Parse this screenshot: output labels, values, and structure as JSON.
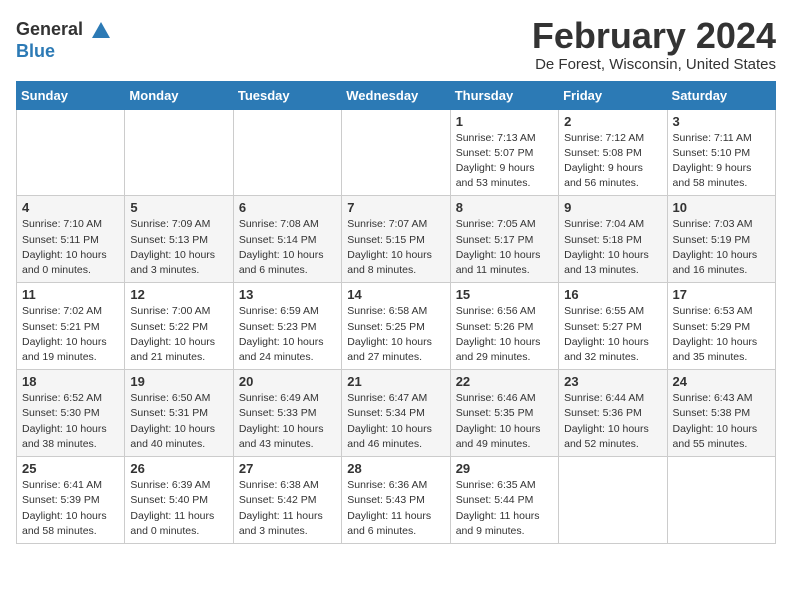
{
  "header": {
    "logo_general": "General",
    "logo_blue": "Blue",
    "month_title": "February 2024",
    "location": "De Forest, Wisconsin, United States"
  },
  "weekdays": [
    "Sunday",
    "Monday",
    "Tuesday",
    "Wednesday",
    "Thursday",
    "Friday",
    "Saturday"
  ],
  "weeks": [
    [
      {
        "day": "",
        "info": ""
      },
      {
        "day": "",
        "info": ""
      },
      {
        "day": "",
        "info": ""
      },
      {
        "day": "",
        "info": ""
      },
      {
        "day": "1",
        "sunrise": "Sunrise: 7:13 AM",
        "sunset": "Sunset: 5:07 PM",
        "daylight": "Daylight: 9 hours and 53 minutes."
      },
      {
        "day": "2",
        "sunrise": "Sunrise: 7:12 AM",
        "sunset": "Sunset: 5:08 PM",
        "daylight": "Daylight: 9 hours and 56 minutes."
      },
      {
        "day": "3",
        "sunrise": "Sunrise: 7:11 AM",
        "sunset": "Sunset: 5:10 PM",
        "daylight": "Daylight: 9 hours and 58 minutes."
      }
    ],
    [
      {
        "day": "4",
        "sunrise": "Sunrise: 7:10 AM",
        "sunset": "Sunset: 5:11 PM",
        "daylight": "Daylight: 10 hours and 0 minutes."
      },
      {
        "day": "5",
        "sunrise": "Sunrise: 7:09 AM",
        "sunset": "Sunset: 5:13 PM",
        "daylight": "Daylight: 10 hours and 3 minutes."
      },
      {
        "day": "6",
        "sunrise": "Sunrise: 7:08 AM",
        "sunset": "Sunset: 5:14 PM",
        "daylight": "Daylight: 10 hours and 6 minutes."
      },
      {
        "day": "7",
        "sunrise": "Sunrise: 7:07 AM",
        "sunset": "Sunset: 5:15 PM",
        "daylight": "Daylight: 10 hours and 8 minutes."
      },
      {
        "day": "8",
        "sunrise": "Sunrise: 7:05 AM",
        "sunset": "Sunset: 5:17 PM",
        "daylight": "Daylight: 10 hours and 11 minutes."
      },
      {
        "day": "9",
        "sunrise": "Sunrise: 7:04 AM",
        "sunset": "Sunset: 5:18 PM",
        "daylight": "Daylight: 10 hours and 13 minutes."
      },
      {
        "day": "10",
        "sunrise": "Sunrise: 7:03 AM",
        "sunset": "Sunset: 5:19 PM",
        "daylight": "Daylight: 10 hours and 16 minutes."
      }
    ],
    [
      {
        "day": "11",
        "sunrise": "Sunrise: 7:02 AM",
        "sunset": "Sunset: 5:21 PM",
        "daylight": "Daylight: 10 hours and 19 minutes."
      },
      {
        "day": "12",
        "sunrise": "Sunrise: 7:00 AM",
        "sunset": "Sunset: 5:22 PM",
        "daylight": "Daylight: 10 hours and 21 minutes."
      },
      {
        "day": "13",
        "sunrise": "Sunrise: 6:59 AM",
        "sunset": "Sunset: 5:23 PM",
        "daylight": "Daylight: 10 hours and 24 minutes."
      },
      {
        "day": "14",
        "sunrise": "Sunrise: 6:58 AM",
        "sunset": "Sunset: 5:25 PM",
        "daylight": "Daylight: 10 hours and 27 minutes."
      },
      {
        "day": "15",
        "sunrise": "Sunrise: 6:56 AM",
        "sunset": "Sunset: 5:26 PM",
        "daylight": "Daylight: 10 hours and 29 minutes."
      },
      {
        "day": "16",
        "sunrise": "Sunrise: 6:55 AM",
        "sunset": "Sunset: 5:27 PM",
        "daylight": "Daylight: 10 hours and 32 minutes."
      },
      {
        "day": "17",
        "sunrise": "Sunrise: 6:53 AM",
        "sunset": "Sunset: 5:29 PM",
        "daylight": "Daylight: 10 hours and 35 minutes."
      }
    ],
    [
      {
        "day": "18",
        "sunrise": "Sunrise: 6:52 AM",
        "sunset": "Sunset: 5:30 PM",
        "daylight": "Daylight: 10 hours and 38 minutes."
      },
      {
        "day": "19",
        "sunrise": "Sunrise: 6:50 AM",
        "sunset": "Sunset: 5:31 PM",
        "daylight": "Daylight: 10 hours and 40 minutes."
      },
      {
        "day": "20",
        "sunrise": "Sunrise: 6:49 AM",
        "sunset": "Sunset: 5:33 PM",
        "daylight": "Daylight: 10 hours and 43 minutes."
      },
      {
        "day": "21",
        "sunrise": "Sunrise: 6:47 AM",
        "sunset": "Sunset: 5:34 PM",
        "daylight": "Daylight: 10 hours and 46 minutes."
      },
      {
        "day": "22",
        "sunrise": "Sunrise: 6:46 AM",
        "sunset": "Sunset: 5:35 PM",
        "daylight": "Daylight: 10 hours and 49 minutes."
      },
      {
        "day": "23",
        "sunrise": "Sunrise: 6:44 AM",
        "sunset": "Sunset: 5:36 PM",
        "daylight": "Daylight: 10 hours and 52 minutes."
      },
      {
        "day": "24",
        "sunrise": "Sunrise: 6:43 AM",
        "sunset": "Sunset: 5:38 PM",
        "daylight": "Daylight: 10 hours and 55 minutes."
      }
    ],
    [
      {
        "day": "25",
        "sunrise": "Sunrise: 6:41 AM",
        "sunset": "Sunset: 5:39 PM",
        "daylight": "Daylight: 10 hours and 58 minutes."
      },
      {
        "day": "26",
        "sunrise": "Sunrise: 6:39 AM",
        "sunset": "Sunset: 5:40 PM",
        "daylight": "Daylight: 11 hours and 0 minutes."
      },
      {
        "day": "27",
        "sunrise": "Sunrise: 6:38 AM",
        "sunset": "Sunset: 5:42 PM",
        "daylight": "Daylight: 11 hours and 3 minutes."
      },
      {
        "day": "28",
        "sunrise": "Sunrise: 6:36 AM",
        "sunset": "Sunset: 5:43 PM",
        "daylight": "Daylight: 11 hours and 6 minutes."
      },
      {
        "day": "29",
        "sunrise": "Sunrise: 6:35 AM",
        "sunset": "Sunset: 5:44 PM",
        "daylight": "Daylight: 11 hours and 9 minutes."
      },
      {
        "day": "",
        "info": ""
      },
      {
        "day": "",
        "info": ""
      }
    ]
  ]
}
